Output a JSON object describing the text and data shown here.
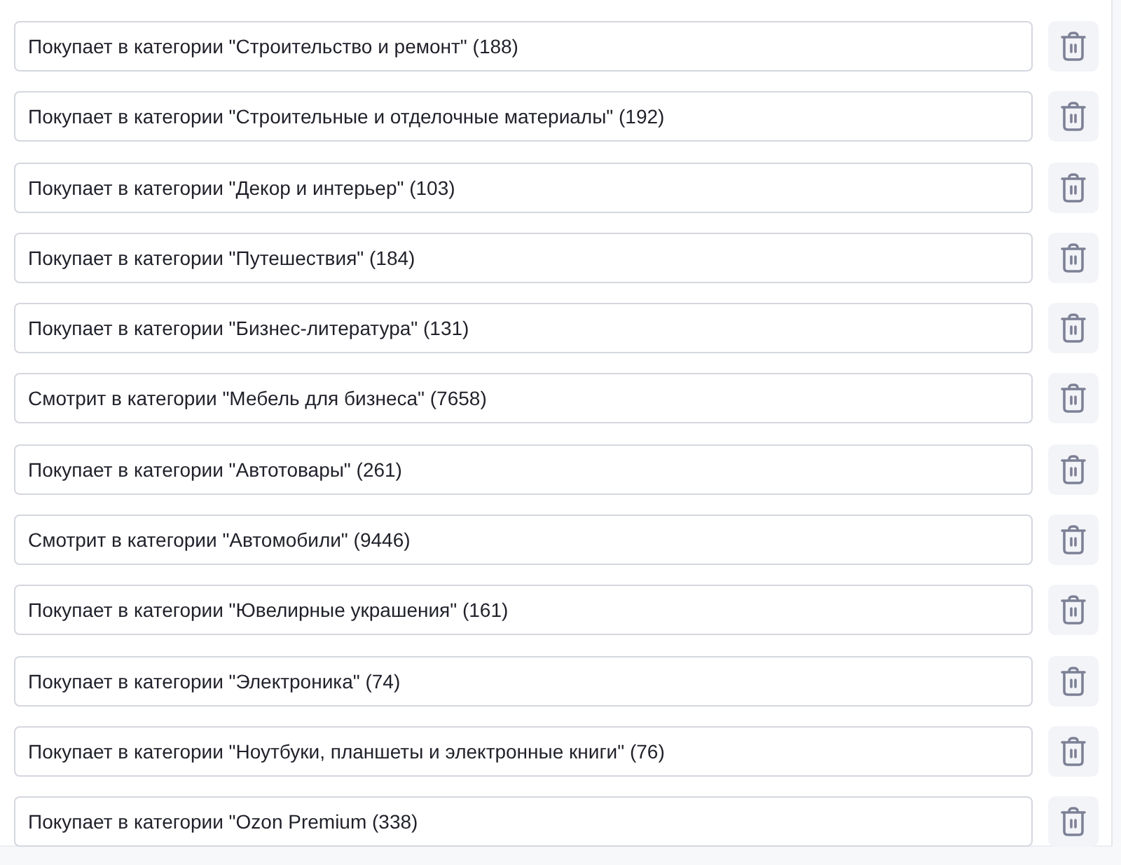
{
  "conditions": [
    {
      "value": "Покупает в категории \"Строительство и ремонт\" (188)"
    },
    {
      "value": "Покупает в категории \"Строительные и отделочные материалы\" (192)"
    },
    {
      "value": "Покупает в категории \"Декор и интерьер\" (103)"
    },
    {
      "value": "Покупает в категории \"Путешествия\" (184)"
    },
    {
      "value": "Покупает в категории \"Бизнес-литература\" (131)"
    },
    {
      "value": "Смотрит в категории \"Мебель для бизнеса\" (7658)"
    },
    {
      "value": "Покупает в категории \"Автотовары\" (261)"
    },
    {
      "value": "Смотрит в категории \"Автомобили\" (9446)"
    },
    {
      "value": "Покупает в категории \"Ювелирные украшения\" (161)"
    },
    {
      "value": "Покупает в категории \"Электроника\" (74)"
    },
    {
      "value": "Покупает в категории \"Ноутбуки, планшеты и электронные книги\" (76)"
    },
    {
      "value": "Покупает в категории \"Ozon Premium (338)"
    }
  ]
}
